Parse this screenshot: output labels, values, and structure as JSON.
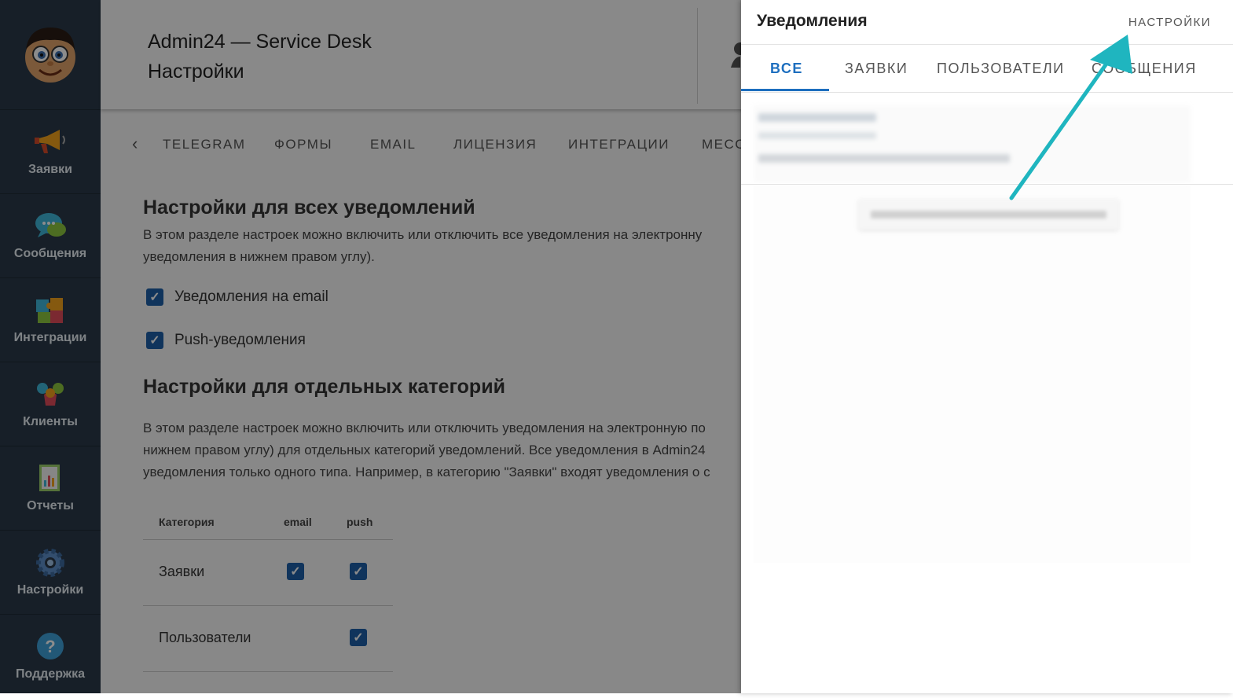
{
  "sidebar": {
    "items": [
      {
        "label": "Заявки",
        "icon": "megaphone-icon"
      },
      {
        "label": "Сообщения",
        "icon": "chat-bubble-icon"
      },
      {
        "label": "Интеграции",
        "icon": "puzzle-icon"
      },
      {
        "label": "Клиенты",
        "icon": "people-icon"
      },
      {
        "label": "Отчеты",
        "icon": "report-icon"
      },
      {
        "label": "Настройки",
        "icon": "gear-icon"
      },
      {
        "label": "Поддержка",
        "icon": "question-icon"
      }
    ]
  },
  "header": {
    "app_name": "Admin24 — Service Desk",
    "page_title": "Настройки"
  },
  "settings_tabs": [
    "TELEGRAM",
    "ФОРМЫ",
    "EMAIL",
    "ЛИЦЕНЗИЯ",
    "ИНТЕГРАЦИИ",
    "МЕСС"
  ],
  "section_all": {
    "heading": "Настройки для всех уведомлений",
    "desc_line1": "В этом разделе настроек можно включить или отключить все уведомления на электронну",
    "desc_line2": "уведомления в нижнем правом углу).",
    "option_email": "Уведомления на email",
    "option_push": "Push-уведомления"
  },
  "section_categories": {
    "heading": "Настройки для отдельных категорий",
    "desc_line1": "В этом разделе настроек можно включить или отключить уведомления на электронную по",
    "desc_line2": "нижнем правом углу) для отдельных категорий уведомлений. Все уведомления в Admin24",
    "desc_line3": "уведомления только одного типа. Например, в категорию \"Заявки\" входят уведомления о с",
    "table": {
      "headers": [
        "Категория",
        "email",
        "push"
      ],
      "rows": [
        {
          "category": "Заявки",
          "email": true,
          "push": true
        },
        {
          "category": "Пользователи",
          "email": false,
          "push": true
        }
      ]
    }
  },
  "panel": {
    "title": "Уведомления",
    "settings_link": "НАСТРОЙКИ",
    "tabs": [
      "ВСЕ",
      "ЗАЯВКИ",
      "ПОЛЬЗОВАТЕЛИ",
      "СООБЩЕНИЯ"
    ],
    "active_tab": "ВСЕ"
  },
  "colors": {
    "accent": "#1e6fbf",
    "sidebar_bg": "#2b3a4a",
    "arrow": "#1fb5bf",
    "checkbox": "#1e5fa8"
  }
}
